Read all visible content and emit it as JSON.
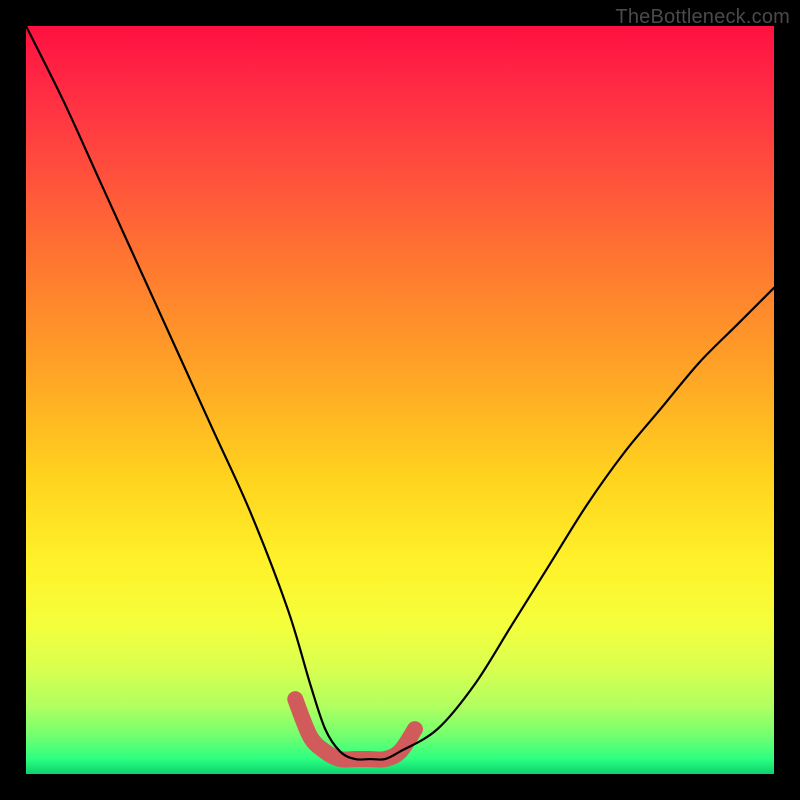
{
  "watermark": "TheBottleneck.com",
  "chart_data": {
    "type": "line",
    "title": "",
    "xlabel": "",
    "ylabel": "",
    "xlim": [
      0,
      100
    ],
    "ylim": [
      0,
      100
    ],
    "series": [
      {
        "name": "bottleneck-curve",
        "x": [
          0,
          5,
          10,
          15,
          20,
          25,
          30,
          35,
          38,
          40,
          42,
          44,
          46,
          48,
          50,
          55,
          60,
          65,
          70,
          75,
          80,
          85,
          90,
          95,
          100
        ],
        "values": [
          100,
          90,
          79,
          68,
          57,
          46,
          35,
          22,
          12,
          6,
          3,
          2,
          2,
          2,
          3,
          6,
          12,
          20,
          28,
          36,
          43,
          49,
          55,
          60,
          65
        ]
      }
    ],
    "highlight": {
      "name": "optimal-zone",
      "x": [
        36,
        38,
        40,
        42,
        44,
        46,
        48,
        50,
        52
      ],
      "values": [
        10,
        5,
        3,
        2,
        2,
        2,
        2,
        3,
        6
      ],
      "color": "#d15a5a",
      "width": 16
    }
  }
}
